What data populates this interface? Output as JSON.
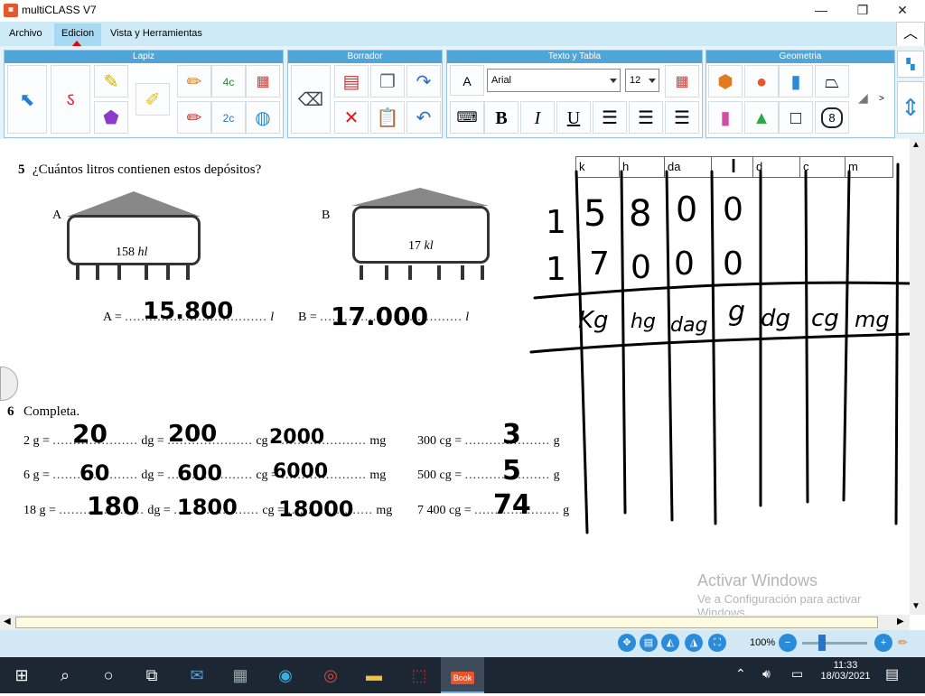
{
  "window": {
    "title": "multiCLASS V7",
    "minimize": "—",
    "maximize": "❐",
    "close": "✕"
  },
  "menu": {
    "items": [
      "Archivo",
      "Edicion",
      "Vista y Herramientas"
    ]
  },
  "ribbon": {
    "groups": [
      "Lapiz",
      "Borrador",
      "Texto y Tabla",
      "Geometria"
    ],
    "font": "Arial",
    "size": "12",
    "bold": "B",
    "italic": "I",
    "underline": "U",
    "collapse": "︿",
    "more": ">",
    "polygon_sides": "8",
    "tool_labels": {
      "t4c": "4c",
      "t2c": "2c"
    }
  },
  "exercise5": {
    "number": "5",
    "question": "¿Cuántos litros contienen estos depósitos?",
    "tank_a": {
      "label": "A",
      "value": "158",
      "unit": "hl"
    },
    "tank_b": {
      "label": "B",
      "value": "17",
      "unit": "kl"
    },
    "answer_a": {
      "prefix": "A =",
      "dots": "...................................",
      "suffix": "l",
      "handwritten": "15.800"
    },
    "answer_b": {
      "prefix": "B =",
      "dots": "...................................",
      "suffix": "l",
      "handwritten": "17.000"
    }
  },
  "exercise6": {
    "number": "6",
    "title": "Completa.",
    "rows": [
      {
        "a": "2 g =",
        "a_hand": "20",
        "b": "dg =",
        "b_hand": "200",
        "c": "cg =",
        "c_hand": "2000",
        "d": "mg"
      },
      {
        "a": "6 g =",
        "a_hand": "60",
        "b": "dg =",
        "b_hand": "600",
        "c": "cg =",
        "c_hand": "6000",
        "d": "mg"
      },
      {
        "a": "18 g =",
        "a_hand": "180",
        "b": "dg =",
        "b_hand": "1800",
        "c": "cg =",
        "c_hand": "18000",
        "d": "mg"
      }
    ],
    "right": [
      {
        "a": "300 cg =",
        "hand": "3",
        "u": "g"
      },
      {
        "a": "500 cg =",
        "hand": "5",
        "u": "g"
      },
      {
        "a": "7 400 cg =",
        "hand": "74",
        "u": "g"
      }
    ],
    "dots": "....................."
  },
  "unit_table": {
    "headers": [
      "k",
      "h",
      "da",
      "l",
      "d",
      "c",
      "m"
    ],
    "row1": [
      "1",
      "5",
      "8",
      "0",
      "0"
    ],
    "row2": [
      "1",
      "7",
      "0",
      "0",
      "0"
    ],
    "bottom_labels": [
      "Kg",
      "hg",
      "dag",
      "g",
      "dg",
      "cg",
      "mg"
    ]
  },
  "watermark": {
    "title": "Activar Windows",
    "line1": "Ve a Configuración para activar",
    "line2": "Windows."
  },
  "status": {
    "zoom": "100%"
  },
  "taskbar": {
    "time": "11:33",
    "date": "18/03/2021",
    "active_app": "Book"
  }
}
